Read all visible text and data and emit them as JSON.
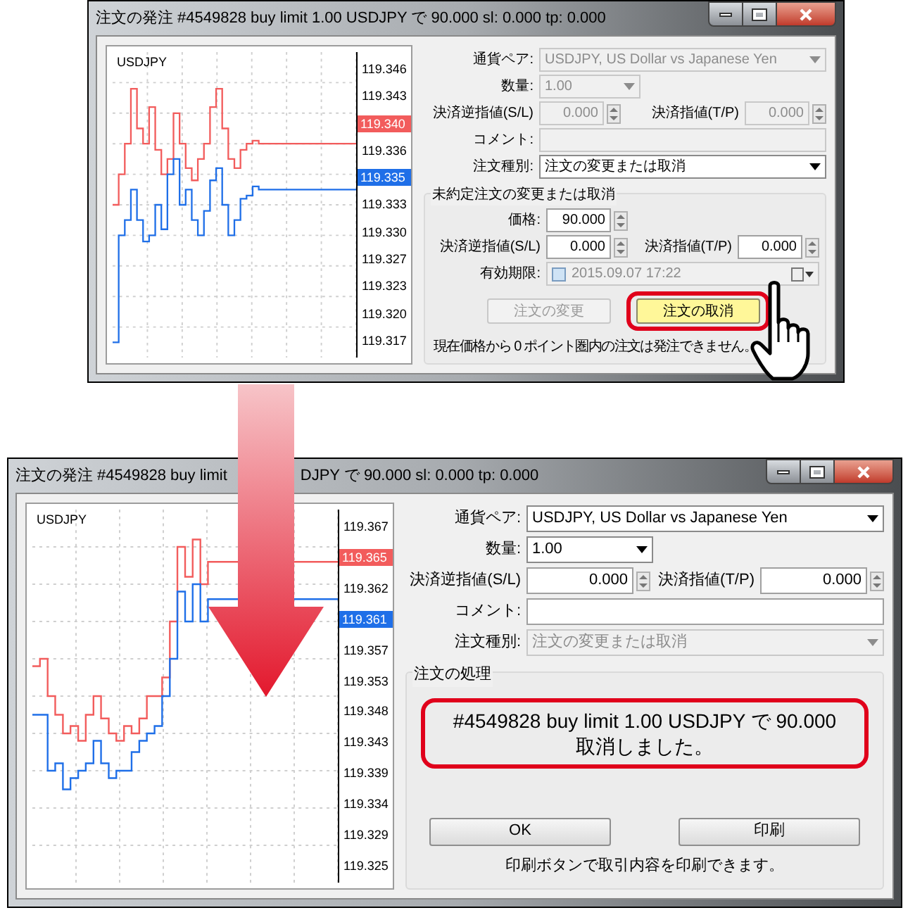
{
  "windows": [
    {
      "title_parts": [
        "注文の発注 #4549828 buy limit 1.00 USDJPY で 90.000 sl: 0.000 tp: 0.000"
      ],
      "chart": {
        "symbol": "USDJPY",
        "axis": [
          {
            "kind": "tick",
            "text": "119.346"
          },
          {
            "kind": "tick",
            "text": "119.343"
          },
          {
            "kind": "tag",
            "text": "119.340",
            "color": "#f25c5c"
          },
          {
            "kind": "tick",
            "text": "119.336"
          },
          {
            "kind": "tag",
            "text": "119.335",
            "color": "#1f6fe8"
          },
          {
            "kind": "tick",
            "text": "119.333"
          },
          {
            "kind": "tick",
            "text": "119.330"
          },
          {
            "kind": "tick",
            "text": "119.327"
          },
          {
            "kind": "tick",
            "text": "119.323"
          },
          {
            "kind": "tick",
            "text": "119.320"
          },
          {
            "kind": "tick",
            "text": "119.317"
          }
        ]
      },
      "fields": [
        {
          "kind": "select",
          "label": "通貨ペア:",
          "value": "USDJPY, US Dollar vs Japanese Yen",
          "disabled": true
        },
        {
          "kind": "select_short",
          "label": "数量:",
          "value": "1.00",
          "disabled": true
        },
        {
          "kind": "pair",
          "label": "決済逆指値(S/L)",
          "value": "0.000",
          "label2": "決済指値(T/P)",
          "value2": "0.000",
          "disabled": true
        },
        {
          "kind": "text",
          "label": "コメント:",
          "disabled": true
        },
        {
          "kind": "select",
          "label": "注文種別:",
          "value": "注文の変更または取消",
          "disabled": false
        }
      ],
      "group": {
        "title": "未約定注文の変更または取消",
        "fields": [
          {
            "kind": "spin",
            "label": "価格:",
            "value": "90.000",
            "disabled": false
          },
          {
            "kind": "pair",
            "label": "決済逆指値(S/L)",
            "value": "0.000",
            "label2": "決済指値(T/P)",
            "value2": "0.000",
            "disabled": false
          },
          {
            "kind": "date",
            "label": "有効期限:",
            "value": "2015.09.07 17:22",
            "checked": false,
            "disabled": true
          }
        ],
        "buttons": [
          {
            "label": "注文の変更",
            "disabled": true,
            "highlighted": false
          },
          {
            "label": "注文の取消",
            "disabled": false,
            "highlighted": true
          }
        ],
        "note": "現在価格から 0 ポイント圏内の注文は発注できません。"
      }
    },
    {
      "title_parts": [
        "注文の発注 #4549828 buy limit",
        "DJPY で 90.000 sl: 0.000 tp: 0.000"
      ],
      "chart": {
        "symbol": "USDJPY",
        "axis": [
          {
            "kind": "tick",
            "text": "119.367"
          },
          {
            "kind": "tag",
            "text": "119.365",
            "color": "#f25c5c"
          },
          {
            "kind": "tick",
            "text": "119.362"
          },
          {
            "kind": "tag",
            "text": "119.361",
            "color": "#1f6fe8"
          },
          {
            "kind": "tick",
            "text": "119.357"
          },
          {
            "kind": "tick",
            "text": "119.353"
          },
          {
            "kind": "tick",
            "text": "119.348"
          },
          {
            "kind": "tick",
            "text": "119.343"
          },
          {
            "kind": "tick",
            "text": "119.339"
          },
          {
            "kind": "tick",
            "text": "119.334"
          },
          {
            "kind": "tick",
            "text": "119.329"
          },
          {
            "kind": "tick",
            "text": "119.325"
          }
        ]
      },
      "fields": [
        {
          "kind": "select",
          "label": "通貨ペア:",
          "value": "USDJPY, US Dollar vs Japanese Yen",
          "disabled": false
        },
        {
          "kind": "select_short",
          "label": "数量:",
          "value": "1.00",
          "disabled": false
        },
        {
          "kind": "pair",
          "label": "決済逆指値(S/L)",
          "value": "0.000",
          "label2": "決済指値(T/P)",
          "value2": "0.000",
          "disabled": false
        },
        {
          "kind": "text",
          "label": "コメント:",
          "disabled": false
        },
        {
          "kind": "select",
          "label": "注文種別:",
          "value": "注文の変更または取消",
          "disabled": true
        }
      ],
      "group": {
        "title": "注文の処理",
        "message_lines": [
          "#4549828 buy limit 1.00 USDJPY で 90.000",
          "取消しました。"
        ],
        "buttons": [
          {
            "label": "OK",
            "disabled": false,
            "highlighted": false
          },
          {
            "label": "印刷",
            "disabled": false,
            "highlighted": false
          }
        ],
        "note": "印刷ボタンで取引内容を印刷できます。"
      }
    }
  ]
}
